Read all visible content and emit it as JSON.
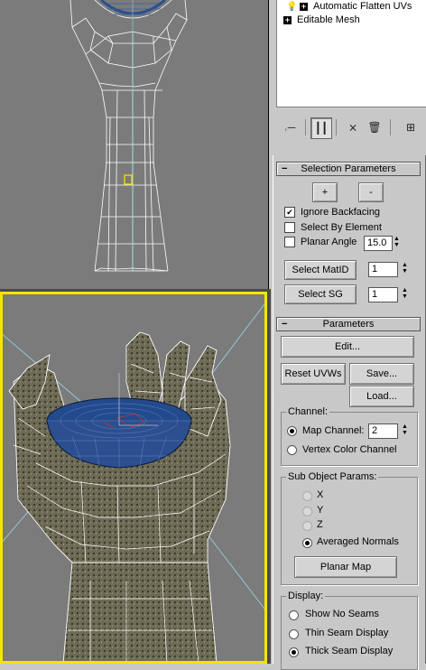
{
  "modifier_stack": {
    "items": [
      {
        "label": "Automatic Flatten UVs",
        "active": true
      },
      {
        "label": "Editable Mesh",
        "active": false
      }
    ]
  },
  "stack_toolbar": {
    "icons": [
      "pin-stack-icon",
      "show-end-result-icon",
      "make-unique-icon",
      "remove-modifier-icon",
      "configure-sets-icon"
    ]
  },
  "selection_parameters": {
    "title": "Selection Parameters",
    "plus_label": "+",
    "minus_label": "-",
    "ignore_backfacing": {
      "label": "Ignore Backfacing",
      "checked": true
    },
    "select_by_element": {
      "label": "Select By Element",
      "checked": false
    },
    "planar_angle": {
      "label": "Planar Angle",
      "checked": false,
      "value": "15.0"
    },
    "select_matid": {
      "label": "Select MatID",
      "value": "1"
    },
    "select_sg": {
      "label": "Select SG",
      "value": "1"
    }
  },
  "parameters": {
    "title": "Parameters",
    "edit_label": "Edit...",
    "reset_uvws_label": "Reset UVWs",
    "save_label": "Save...",
    "load_label": "Load...",
    "channel": {
      "group_label": "Channel:",
      "map_channel_label": "Map Channel:",
      "map_channel_value": "2",
      "vertex_color_label": "Vertex Color Channel",
      "selected": "map"
    },
    "sub_object": {
      "group_label": "Sub Object Params:",
      "x_label": "X",
      "y_label": "Y",
      "z_label": "Z",
      "averaged_label": "Averaged Normals",
      "planar_map_label": "Planar Map",
      "selected": "averaged"
    },
    "display": {
      "group_label": "Display:",
      "show_no_seams": "Show No Seams",
      "thin_seam": "Thin Seam Display",
      "thick_seam": "Thick Seam Display",
      "selected": "thick"
    }
  },
  "colors": {
    "viewport_bg": "#7b7b7b",
    "active_viewport_border": "#f5e400",
    "wire": "#ffffff",
    "bowl": "#2b4f8f",
    "panel_bg": "#c8c8c8"
  }
}
